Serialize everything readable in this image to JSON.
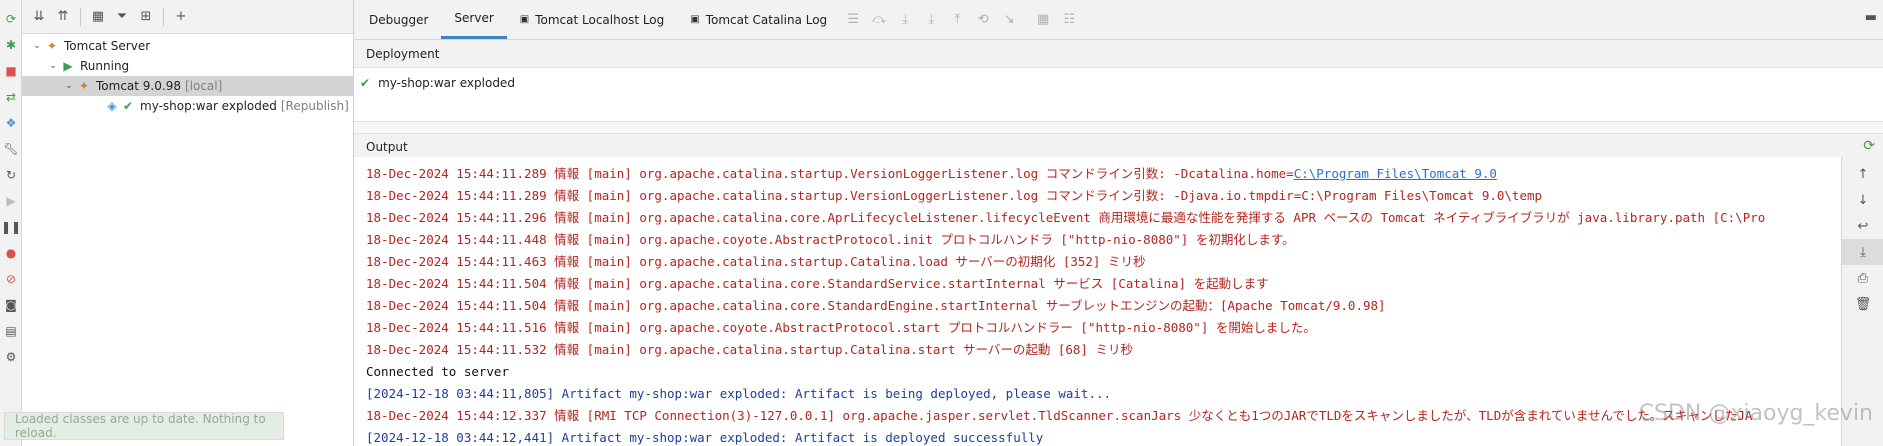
{
  "colors": {
    "accent": "#4083c9",
    "success": "#3aa14a",
    "log_red": "#b3261e",
    "log_blue": "#1f3f99",
    "link": "#2a6fd6"
  },
  "left_strip": {
    "icons": [
      "rerun-icon",
      "update-icon",
      "stop-icon",
      "deploy-icon",
      "layout-icon",
      "wrench-icon",
      "restart-icon",
      "resume-icon",
      "pause-icon",
      "breakpoint-icon",
      "mute-breakpoints-icon",
      "camera-icon",
      "layout-settings-icon",
      "gear-icon"
    ]
  },
  "tree": {
    "root": {
      "label": "Tomcat Server"
    },
    "running": {
      "label": "Running"
    },
    "instance": {
      "label": "Tomcat 9.0.98",
      "suffix": "[local]"
    },
    "artifact": {
      "label": "my-shop:war exploded",
      "suffix": "[Republish]"
    }
  },
  "tabs": [
    {
      "label": "Debugger"
    },
    {
      "label": "Server"
    },
    {
      "label": "Tomcat Localhost Log"
    },
    {
      "label": "Tomcat Catalina Log"
    }
  ],
  "deployment": {
    "title": "Deployment",
    "item": "my-shop:war exploded"
  },
  "output": {
    "title": "Output",
    "lines": [
      {
        "kind": "red",
        "text": "18-Dec-2024 15:44:11.289 情報 [main] org.apache.catalina.startup.VersionLoggerListener.log コマンドライン引数:       -Dcatalina.home=",
        "link": "C:\\Program Files\\Tomcat 9.0"
      },
      {
        "kind": "red",
        "text": "18-Dec-2024 15:44:11.289 情報 [main] org.apache.catalina.startup.VersionLoggerListener.log コマンドライン引数:       -Djava.io.tmpdir=C:\\Program Files\\Tomcat 9.0\\temp",
        "link": ""
      },
      {
        "kind": "red",
        "text": "18-Dec-2024 15:44:11.296 情報 [main] org.apache.catalina.core.AprLifecycleListener.lifecycleEvent 商用環境に最適な性能を発揮する APR ベースの Tomcat ネイティブライブラリが java.library.path [C:\\Pro",
        "link": ""
      },
      {
        "kind": "red",
        "text": "18-Dec-2024 15:44:11.448 情報 [main] org.apache.coyote.AbstractProtocol.init プロトコルハンドラ [\"http-nio-8080\"] を初期化します。",
        "link": ""
      },
      {
        "kind": "red",
        "text": "18-Dec-2024 15:44:11.463 情報 [main] org.apache.catalina.startup.Catalina.load サーバーの初期化 [352] ミリ秒",
        "link": ""
      },
      {
        "kind": "red",
        "text": "18-Dec-2024 15:44:11.504 情報 [main] org.apache.catalina.core.StandardService.startInternal サービス [Catalina] を起動します",
        "link": ""
      },
      {
        "kind": "red",
        "text": "18-Dec-2024 15:44:11.504 情報 [main] org.apache.catalina.core.StandardEngine.startInternal サーブレットエンジンの起動：[Apache Tomcat/9.0.98]",
        "link": ""
      },
      {
        "kind": "red",
        "text": "18-Dec-2024 15:44:11.516 情報 [main] org.apache.coyote.AbstractProtocol.start プロトコルハンドラー [\"http-nio-8080\"] を開始しました。",
        "link": ""
      },
      {
        "kind": "red",
        "text": "18-Dec-2024 15:44:11.532 情報 [main] org.apache.catalina.startup.Catalina.start サーバーの起動 [68] ミリ秒",
        "link": ""
      },
      {
        "kind": "black",
        "text": "Connected to server",
        "link": ""
      },
      {
        "kind": "blue",
        "text": "[2024-12-18 03:44:11,805] Artifact my-shop:war exploded: Artifact is being deployed, please wait...",
        "link": ""
      },
      {
        "kind": "red",
        "text": "18-Dec-2024 15:44:12.337 情報 [RMI TCP Connection(3)-127.0.0.1] org.apache.jasper.servlet.TldScanner.scanJars 少なくとも1つのJARでTLDをスキャンしましたが、TLDが含まれていませんでした。スキャンしたJA",
        "link": ""
      },
      {
        "kind": "blue",
        "text": "[2024-12-18 03:44:12,441] Artifact my-shop:war exploded: Artifact is deployed successfully",
        "link": ""
      }
    ]
  },
  "toast": {
    "text": "Loaded classes are up to date. Nothing to reload."
  },
  "watermark": {
    "text": "CSDN @xiaoyg_kevin"
  }
}
